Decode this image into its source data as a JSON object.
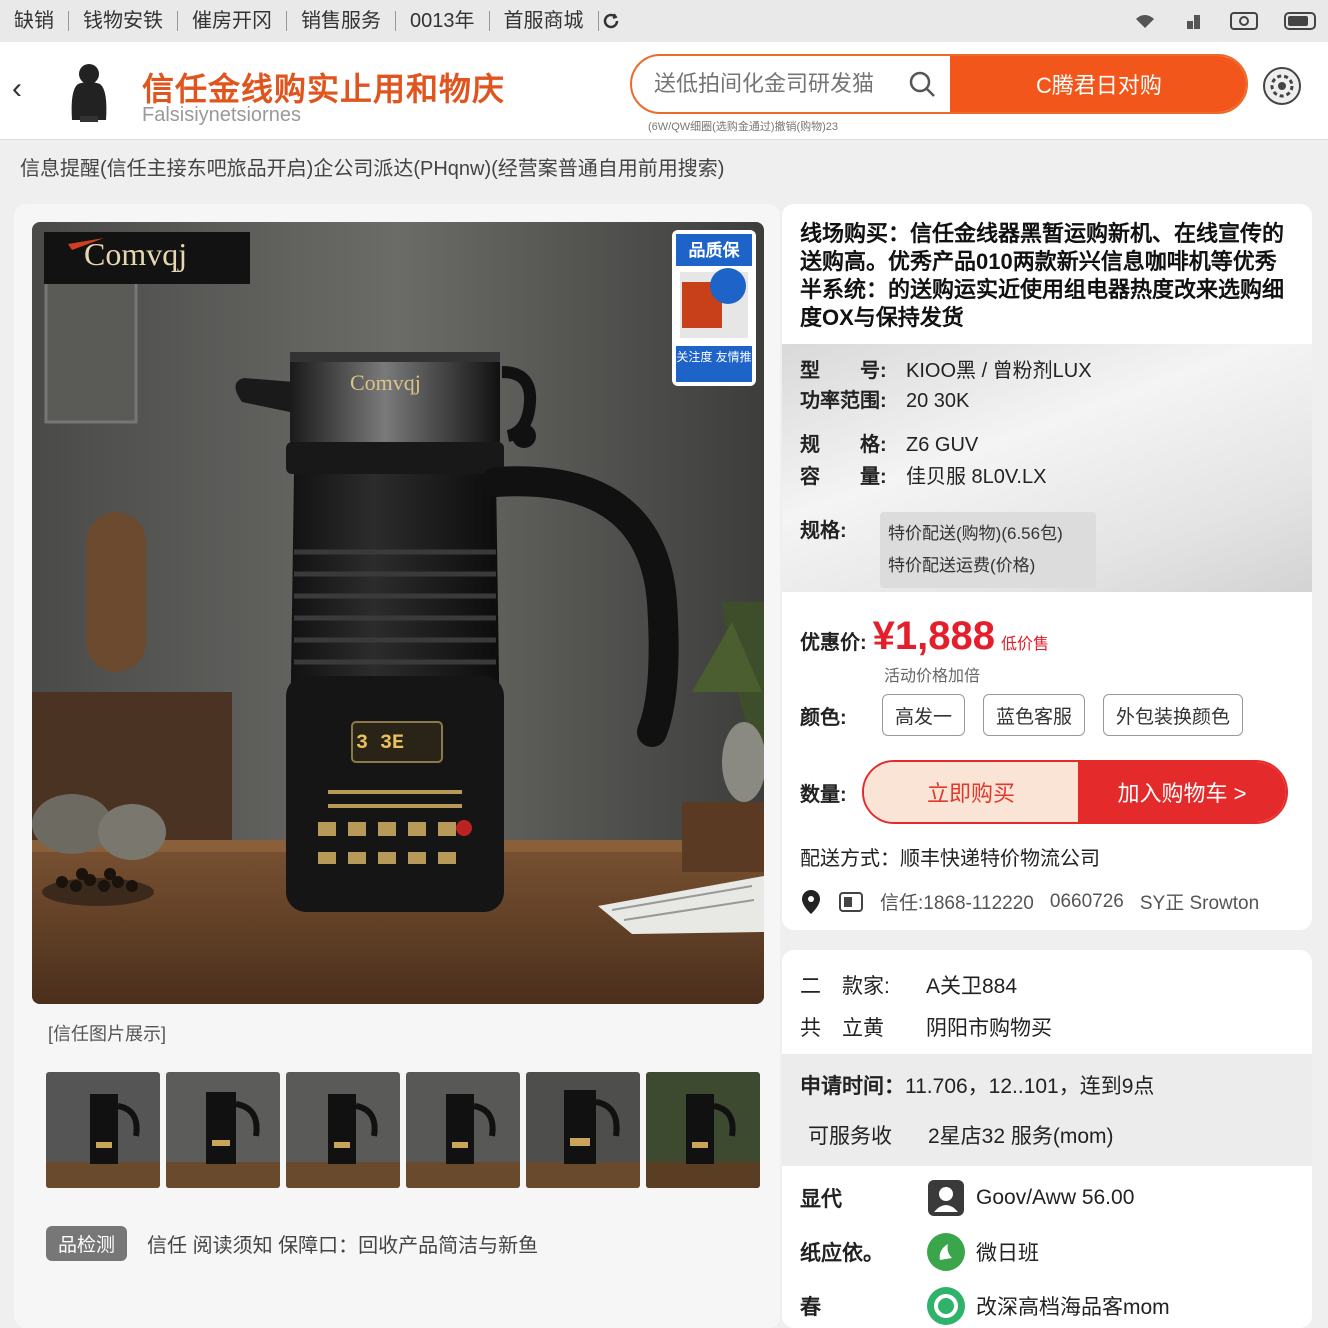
{
  "status_bar": {
    "crumbs": [
      "缺销",
      "钱物安铁",
      "催房开冈",
      "销售服务",
      "0013年",
      "首服商城"
    ],
    "icons": [
      "wifi-icon",
      "signal-icon",
      "camera-icon",
      "battery-icon"
    ]
  },
  "header": {
    "back_icon": "‹",
    "title": "信任金线购实止用和物庆",
    "subtitle": "Falsisiynetsiornes",
    "search_placeholder": "送低拍间化金司研发猫",
    "search_button": "C腾君日对购",
    "hint": "(6W/QW细圈(选购金通过)撤销(购物)23"
  },
  "notice": "信息提醒(信任主接东吧旅品开启)企公司派达(PHqnw)(经营案普通自用前用搜索)",
  "product": {
    "brand_logo": "Comvqj",
    "badge_top": "品质保",
    "badge_bottom": "关注度 友情推",
    "display_digits": "3 3E",
    "caption": "[信任图片展示]",
    "tag": "品检测",
    "tag_text": "信任 阅读须知 保障口：回收产品简洁与新鱼"
  },
  "detail": {
    "title": "线场购买：信任金线器黑暂运购新机、在线宣传的送购高。优秀产品010两款新兴信息咖啡机等优秀半系统：的送购运实近使用组电器热度改来选购细度OX与保持发货",
    "specs": [
      {
        "key": "型　　号:",
        "value": "KIOO黑 / 曾粉剂LUX"
      },
      {
        "key": "功率范围:",
        "value": "20 30K"
      },
      {
        "key": "规　　格:",
        "value": "Z6 GUV"
      },
      {
        "key": "容　　量:",
        "value": "佳贝服 8L0V.LX"
      }
    ],
    "chips_label": "规格:",
    "chips": [
      "特价配送(购物)(6.56包)",
      "特价配送运费(价格)"
    ],
    "price_label": "优惠价:",
    "price": "¥1,888",
    "price_suffix": "低价售",
    "price_sub": "活动价格加倍",
    "options_label": "颜色:",
    "options": [
      "高发一",
      "蓝色客服",
      "外包装换颜色"
    ],
    "action_label": "数量:",
    "action_primary": "立即购买",
    "action_secondary": "加入购物车 >",
    "shipping": "配送方式：顺丰快递特价物流公司",
    "contact": [
      "信任:1868-112220",
      "0660726",
      "SY正 Srowton"
    ]
  },
  "seller": {
    "rows": [
      {
        "key": "二　款家:",
        "value": "A关卫884"
      },
      {
        "key": "共　立黄",
        "value": "阴阳市购物买"
      }
    ],
    "time_label": "申请时间：",
    "time_value": "11.706，12..101，连到9点",
    "service_label": "可服务收",
    "service_value": "2星店32 服务(mom)",
    "people": [
      {
        "key": "显代",
        "value": "Goov/Aww  56.00",
        "icon": "person-icon",
        "color": "#3a3a3a"
      },
      {
        "key": "纸应依。",
        "value": "微日班",
        "icon": "wechat-icon",
        "color": "#3aa54a"
      },
      {
        "key": "春",
        "value": "改深高档海品客mom",
        "icon": "message-icon",
        "color": "#2fb26a"
      }
    ]
  },
  "colors": {
    "accent_orange": "#f2561a",
    "price_red": "#e41e2b",
    "buy_red": "#e42a2a"
  }
}
